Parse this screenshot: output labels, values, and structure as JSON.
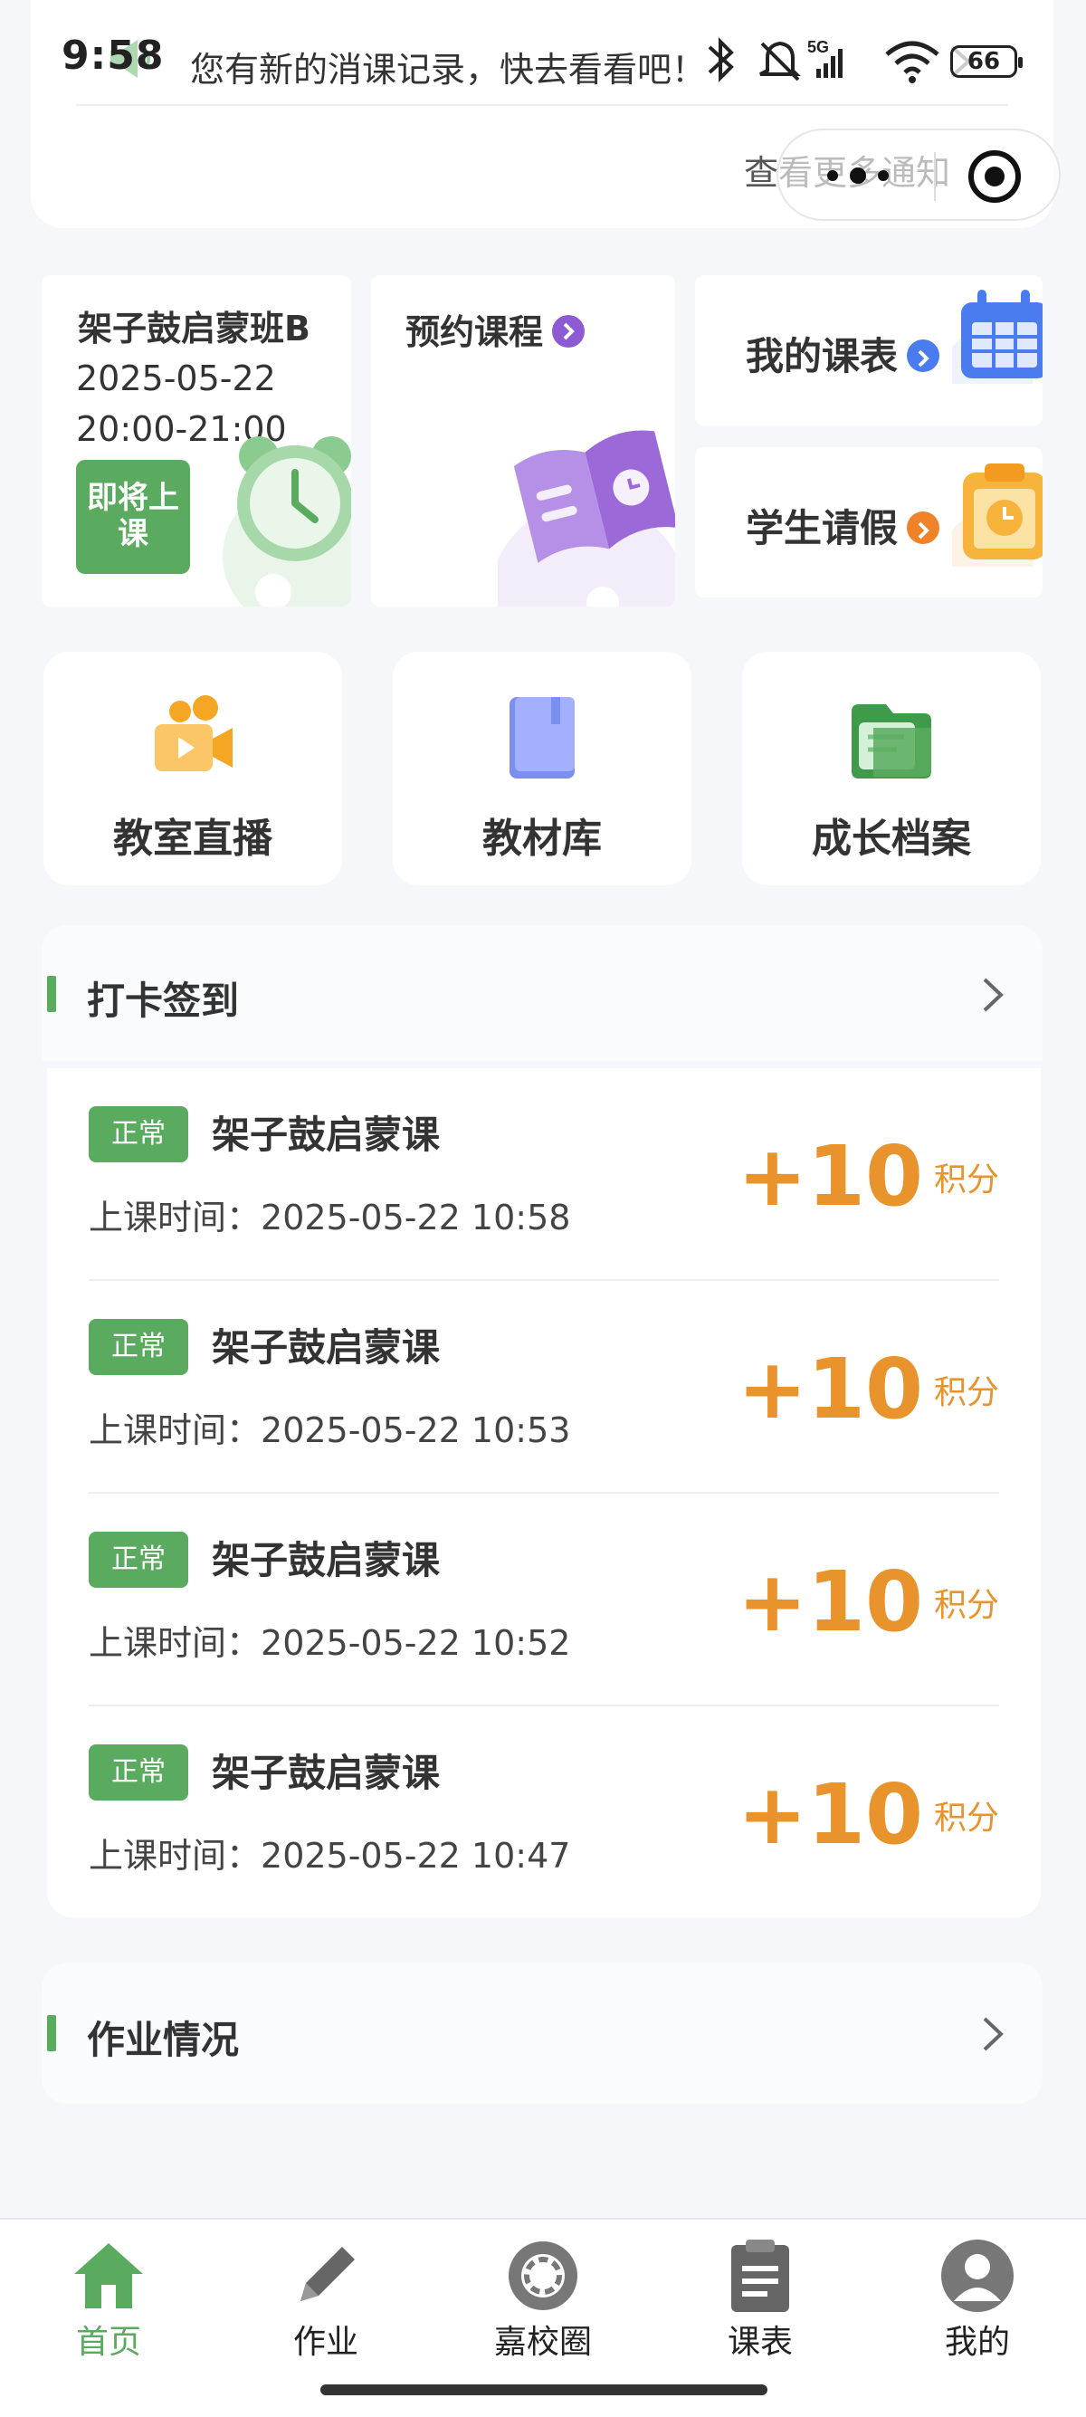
{
  "status_bar": {
    "time": "9:58",
    "network": "5G",
    "battery": "66"
  },
  "notice": {
    "text": "您有新的消课记录，快去看看吧！",
    "more_label": "查看更多通知"
  },
  "class_card": {
    "title": "架子鼓启蒙班B",
    "date": "2025-05-22",
    "time": "20:00-21:00",
    "status_button": "即将上课"
  },
  "booking_card": {
    "title": "预约课程"
  },
  "schedule_card": {
    "title": "我的课表"
  },
  "leave_card": {
    "title": "学生请假"
  },
  "tiles": [
    {
      "label": "教室直播",
      "icon": "video-camera-icon"
    },
    {
      "label": "教材库",
      "icon": "book-icon"
    },
    {
      "label": "成长档案",
      "icon": "folder-icon"
    }
  ],
  "checkin": {
    "title": "打卡签到",
    "items": [
      {
        "status": "正常",
        "course": "架子鼓启蒙课",
        "time_label": "上课时间：",
        "time": "2025-05-22 10:58",
        "points": "+10",
        "unit": "积分"
      },
      {
        "status": "正常",
        "course": "架子鼓启蒙课",
        "time_label": "上课时间：",
        "time": "2025-05-22 10:53",
        "points": "+10",
        "unit": "积分"
      },
      {
        "status": "正常",
        "course": "架子鼓启蒙课",
        "time_label": "上课时间：",
        "time": "2025-05-22 10:52",
        "points": "+10",
        "unit": "积分"
      },
      {
        "status": "正常",
        "course": "架子鼓启蒙课",
        "time_label": "上课时间：",
        "time": "2025-05-22 10:47",
        "points": "+10",
        "unit": "积分"
      }
    ]
  },
  "homework": {
    "title": "作业情况"
  },
  "tabbar": {
    "items": [
      {
        "label": "首页",
        "active": true
      },
      {
        "label": "作业",
        "active": false
      },
      {
        "label": "嘉校圈",
        "active": false
      },
      {
        "label": "课表",
        "active": false
      },
      {
        "label": "我的",
        "active": false
      }
    ]
  },
  "colors": {
    "accent": "#5aab5f",
    "points": "#e8932c",
    "purple": "#8e5ad4",
    "blue": "#4a7cf0",
    "orange": "#f0822a"
  }
}
